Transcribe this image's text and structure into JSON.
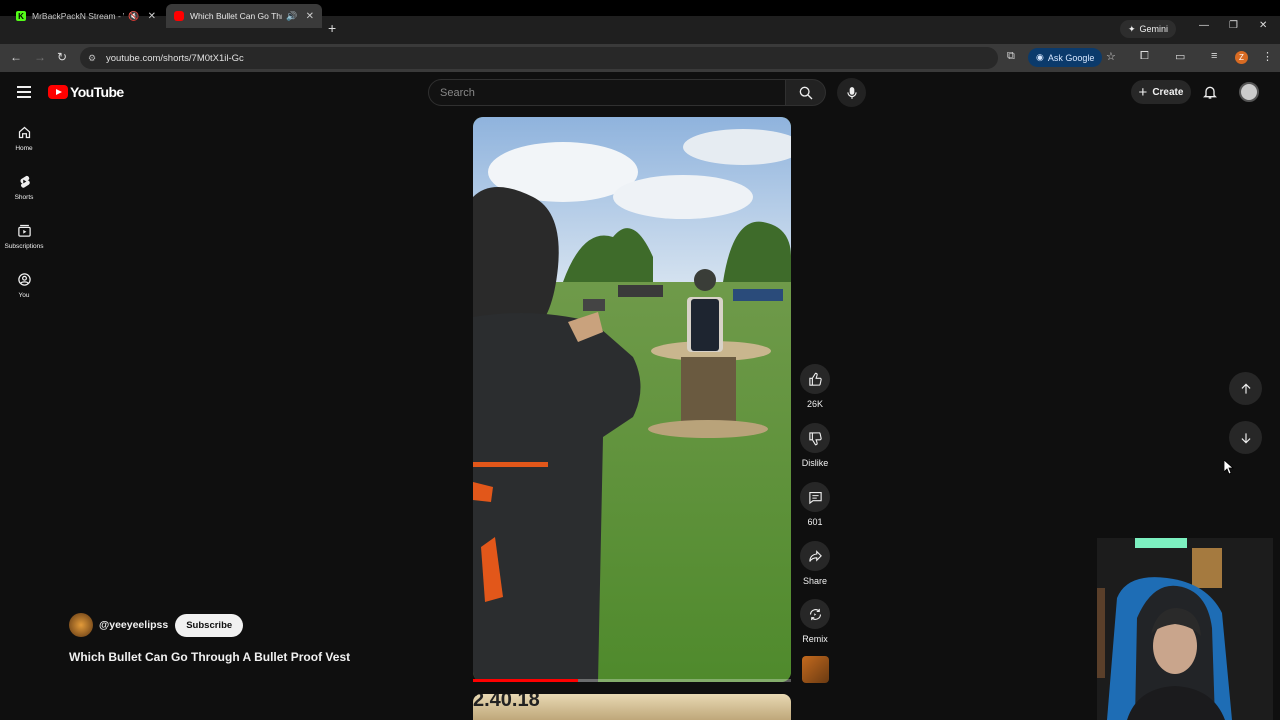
{
  "browser": {
    "tabs": [
      {
        "title": "MrBackPackN Stream - Wa",
        "favicon": "kick-icon",
        "active": false
      },
      {
        "title": "Which Bullet Can Go Throu",
        "favicon": "youtube-icon",
        "active": true
      }
    ],
    "gemini_label": "Gemini",
    "url": "youtube.com/shorts/7M0tX1il-Gc",
    "ask_google_label": "Ask Google",
    "profile_initial": "Z"
  },
  "youtube": {
    "logo_text": "YouTube",
    "search_placeholder": "Search",
    "create_label": "Create",
    "sidebar": [
      {
        "label": "Home",
        "icon": "home-icon"
      },
      {
        "label": "Shorts",
        "icon": "shorts-icon"
      },
      {
        "label": "Subscriptions",
        "icon": "subscriptions-icon"
      },
      {
        "label": "You",
        "icon": "you-icon"
      }
    ]
  },
  "short": {
    "channel_handle": "@yeeyeelipss",
    "subscribe_label": "Subscribe",
    "title": "Which Bullet Can Go Through A Bullet Proof Vest",
    "progress": 0.33,
    "next_short_text": "2.40.18",
    "actions": {
      "likes": "26K",
      "dislike": "Dislike",
      "comments": "601",
      "share": "Share",
      "remix": "Remix"
    }
  }
}
